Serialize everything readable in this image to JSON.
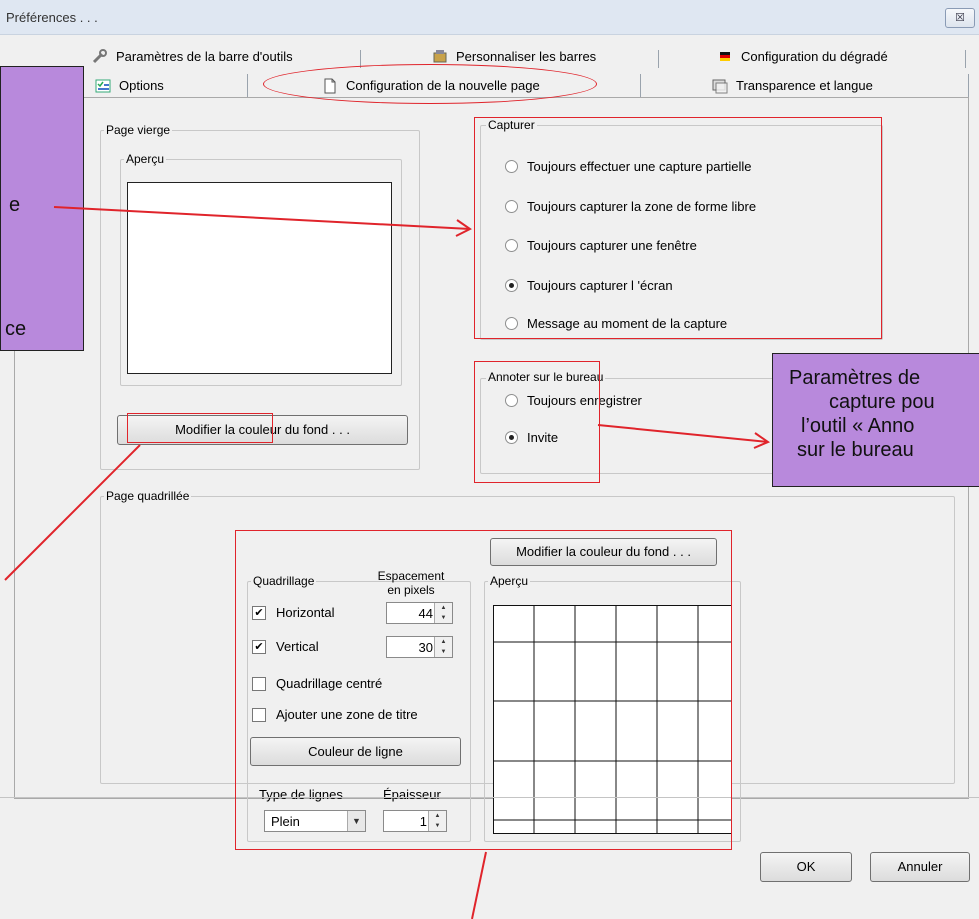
{
  "window": {
    "title": "Préférences . . .",
    "close_label": "☒"
  },
  "tabs_row1": [
    {
      "label": "Paramètres de la barre d'outils",
      "icon": "wrench-icon"
    },
    {
      "label": "Personnaliser les barres",
      "icon": "toolbar-custom-icon"
    },
    {
      "label": "Configuration du dégradé",
      "icon": "flag-gradient-icon"
    }
  ],
  "tabs_row2": [
    {
      "label": "Options",
      "icon": "options-icon"
    },
    {
      "label": "Configuration de la nouvelle page",
      "icon": "page-icon"
    },
    {
      "label": "Transparence et langue",
      "icon": "transparency-icon"
    }
  ],
  "blank_page": {
    "group_label": "Page vierge",
    "preview_label": "Aperçu",
    "bg_button": "Modifier la couleur du fond . . ."
  },
  "capture": {
    "group_label": "Capturer",
    "options": [
      {
        "label": "Toujours effectuer une capture partielle",
        "selected": false
      },
      {
        "label": "Toujours capturer la zone de forme libre",
        "selected": false
      },
      {
        "label": "Toujours capturer une fenêtre",
        "selected": false
      },
      {
        "label": "Toujours capturer l 'écran",
        "selected": true
      },
      {
        "label": "Message au moment de la capture",
        "selected": false
      }
    ]
  },
  "desktop_annotate": {
    "group_label": "Annoter sur le bureau",
    "options": [
      {
        "label": "Toujours enregistrer",
        "selected": false
      },
      {
        "label": "Invite",
        "selected": true
      }
    ]
  },
  "grid_page": {
    "group_label": "Page quadrillée",
    "bg_button": "Modifier la couleur du fond . . .",
    "grid_group_label": "Quadrillage",
    "spacing_label_1": "Espacement",
    "spacing_label_2": "en pixels",
    "horizontal_label": "Horizontal",
    "horizontal_checked": true,
    "horizontal_value": "44",
    "vertical_label": "Vertical",
    "vertical_checked": true,
    "vertical_value": "30",
    "centered_label": "Quadrillage centré",
    "centered_checked": false,
    "title_zone_label": "Ajouter une zone de titre",
    "title_zone_checked": false,
    "line_color_button": "Couleur de ligne",
    "line_type_label": "Type de lignes",
    "line_type_value": "Plein",
    "thickness_label": "Épaisseur",
    "thickness_value": "1",
    "preview_label": "Aperçu"
  },
  "footer": {
    "ok": "OK",
    "cancel": "Annuler"
  },
  "callouts": {
    "left_fragments": [
      "e",
      "ce"
    ],
    "right_lines": [
      "Paramètres de",
      "capture pou",
      "l’outil « Anno",
      "sur le bureau"
    ]
  },
  "colors": {
    "annotation_red": "#e0242b",
    "callout_purple": "#b889dc"
  }
}
